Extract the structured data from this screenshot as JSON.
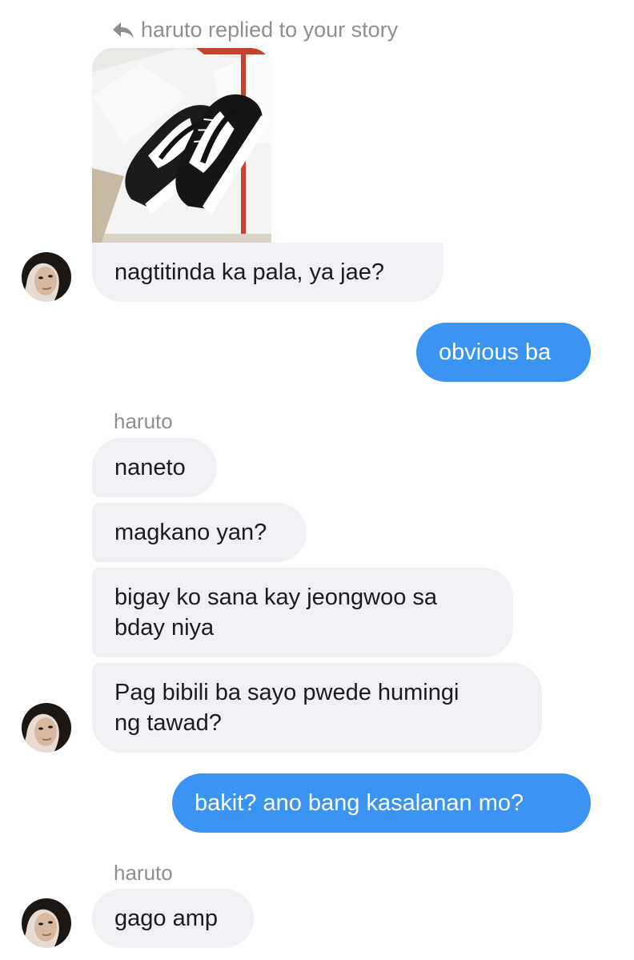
{
  "story_reply": {
    "header_text": "haruto replied to your story",
    "icon": "reply-arrow-icon"
  },
  "colors": {
    "incoming_bubble": "#f0f0f5",
    "outgoing_bubble": "#3b94f2",
    "meta_text": "#8e8e93"
  },
  "messages": [
    {
      "direction": "in",
      "text": "nagtitinda ka pala, ya jae?"
    },
    {
      "direction": "out",
      "text": "obvious ba"
    },
    {
      "direction": "in",
      "sender": "haruto",
      "text": "naneto"
    },
    {
      "direction": "in",
      "text": "magkano yan?"
    },
    {
      "direction": "in",
      "text": "bigay ko sana kay jeongwoo sa",
      "text2": "bday niya"
    },
    {
      "direction": "in",
      "text": "Pag bibili ba sayo pwede humingi",
      "text2": "ng tawad?"
    },
    {
      "direction": "out",
      "text": "bakit? ano bang kasalanan mo?"
    },
    {
      "direction": "in",
      "sender": "haruto",
      "text": "gago amp"
    }
  ]
}
